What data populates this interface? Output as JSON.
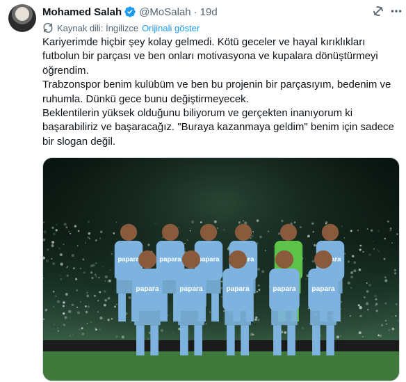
{
  "tweet": {
    "author_name": "Mohamed Salah",
    "handle": "@MoSalah",
    "separator": "·",
    "time": "19d",
    "verified_icon": "verified-badge-icon",
    "translation": {
      "source_label": "Kaynak dili: İngilizce",
      "show_original": "Orijinali göster"
    },
    "text_lines": [
      "Kariyerimde hiçbir şey kolay gelmedi. Kötü geceler ve hayal kırıklıkları",
      "futbolun bir parçası ve ben onları motivasyona ve kupalara dönüştürmeyi",
      "öğrendim.",
      "Trabzonspor benim kulübüm ve ben bu projenin bir parçasıyım, bedenim ve",
      "ruhumla. Dünkü gece bunu değiştirmeyecek.",
      "Beklentilerin yüksek olduğunu biliyorum ve gerçekten inanıyorum ki",
      "başarabiliriz ve başaracağız. \"Buraya kazanmaya geldim\" benim için sadece",
      "bir slogan değil."
    ],
    "media": {
      "kind": "team-photo",
      "jersey_sponsor": "papara"
    }
  },
  "colors": {
    "accent": "#1d9bf0",
    "text": "#0f1419",
    "muted": "#536471",
    "jersey": "#7db3de",
    "keeper": "#5cc24a"
  }
}
